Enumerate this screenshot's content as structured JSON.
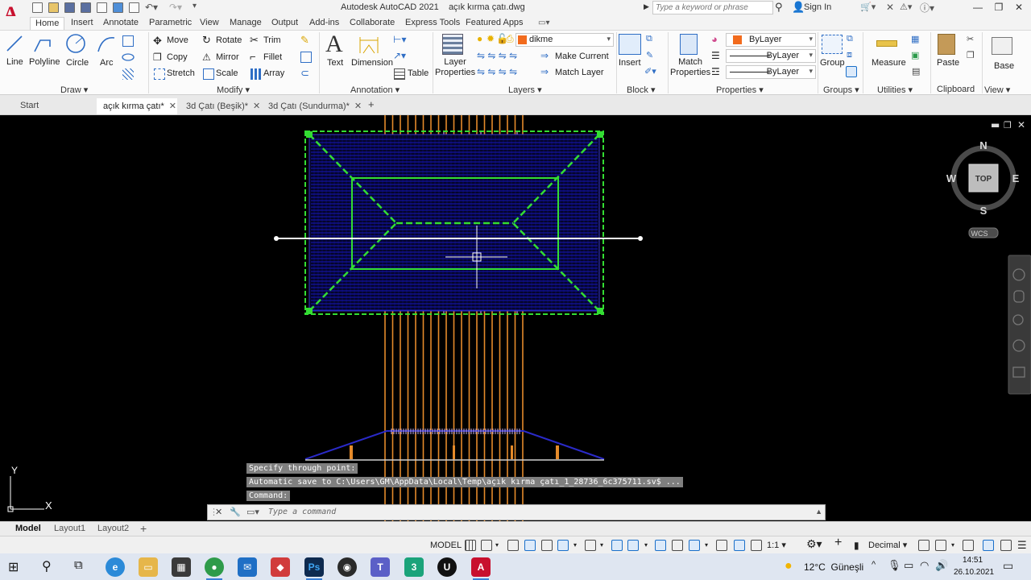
{
  "titlebar": {
    "app_name": "Autodesk AutoCAD 2021",
    "file_name": "açık kırma çatı.dwg",
    "search_placeholder": "Type a keyword or phrase",
    "sign_in": "Sign In",
    "logo_letter": "A"
  },
  "ribbon_tabs": [
    "Home",
    "Insert",
    "Annotate",
    "Parametric",
    "View",
    "Manage",
    "Output",
    "Add-ins",
    "Collaborate",
    "Express Tools",
    "Featured Apps"
  ],
  "active_ribbon_tab": "Home",
  "draw": {
    "title": "Draw",
    "line": "Line",
    "polyline": "Polyline",
    "circle": "Circle",
    "arc": "Arc"
  },
  "modify": {
    "title": "Modify",
    "move": "Move",
    "rotate": "Rotate",
    "trim": "Trim",
    "copy": "Copy",
    "mirror": "Mirror",
    "fillet": "Fillet",
    "stretch": "Stretch",
    "scale": "Scale",
    "array": "Array"
  },
  "annotation": {
    "title": "Annotation",
    "text": "Text",
    "dimension": "Dimension",
    "table": "Table"
  },
  "layers": {
    "title": "Layers",
    "layer_properties_1": "Layer",
    "layer_properties_2": "Properties",
    "current_layer": "dikme",
    "make_current": "Make Current",
    "match_layer": "Match Layer"
  },
  "block": {
    "title": "Block",
    "insert": "Insert"
  },
  "properties": {
    "title": "Properties",
    "match_1": "Match",
    "match_2": "Properties",
    "color": "ByLayer",
    "linetype": "ByLayer",
    "lineweight": "ByLayer"
  },
  "groups": {
    "title": "Groups",
    "group": "Group"
  },
  "utilities": {
    "title": "Utilities",
    "measure": "Measure"
  },
  "clipboard": {
    "title": "Clipboard",
    "paste": "Paste"
  },
  "view_panel": {
    "title": "View",
    "base": "Base"
  },
  "doc_tabs": [
    "Start",
    "açık kırma çatı*",
    "3d Çatı (Beşik)*",
    "3d Çatı (Sundurma)*"
  ],
  "active_doc_tab": "açık kırma çatı*",
  "viewcube": {
    "north": "N",
    "south": "S",
    "east": "E",
    "west": "W",
    "face": "TOP",
    "wcs": "WCS"
  },
  "ucs": {
    "y": "Y",
    "x": "X"
  },
  "command_history": [
    "Specify through point:",
    "Automatic save to C:\\Users\\GM\\AppData\\Local\\Temp\\açık kırma çatı_1_28736_6c375711.sv$ ...",
    "Command:"
  ],
  "command_placeholder": "Type a command",
  "layout_tabs": [
    "Model",
    "Layout1",
    "Layout2"
  ],
  "active_layout": "Model",
  "statusbar": {
    "model": "MODEL",
    "scale": "1:1",
    "units": "Decimal"
  },
  "taskbar": {
    "temperature": "12°C",
    "weather": "Güneşli",
    "time": "14:51",
    "date": "26.10.2021"
  },
  "colors": {
    "roof_blue": "#1515b8",
    "hip_green": "#33dd33",
    "rafter_orange": "#e58a2a",
    "ridge_pink": "#c080c0",
    "accent_red": "#c8102e"
  }
}
